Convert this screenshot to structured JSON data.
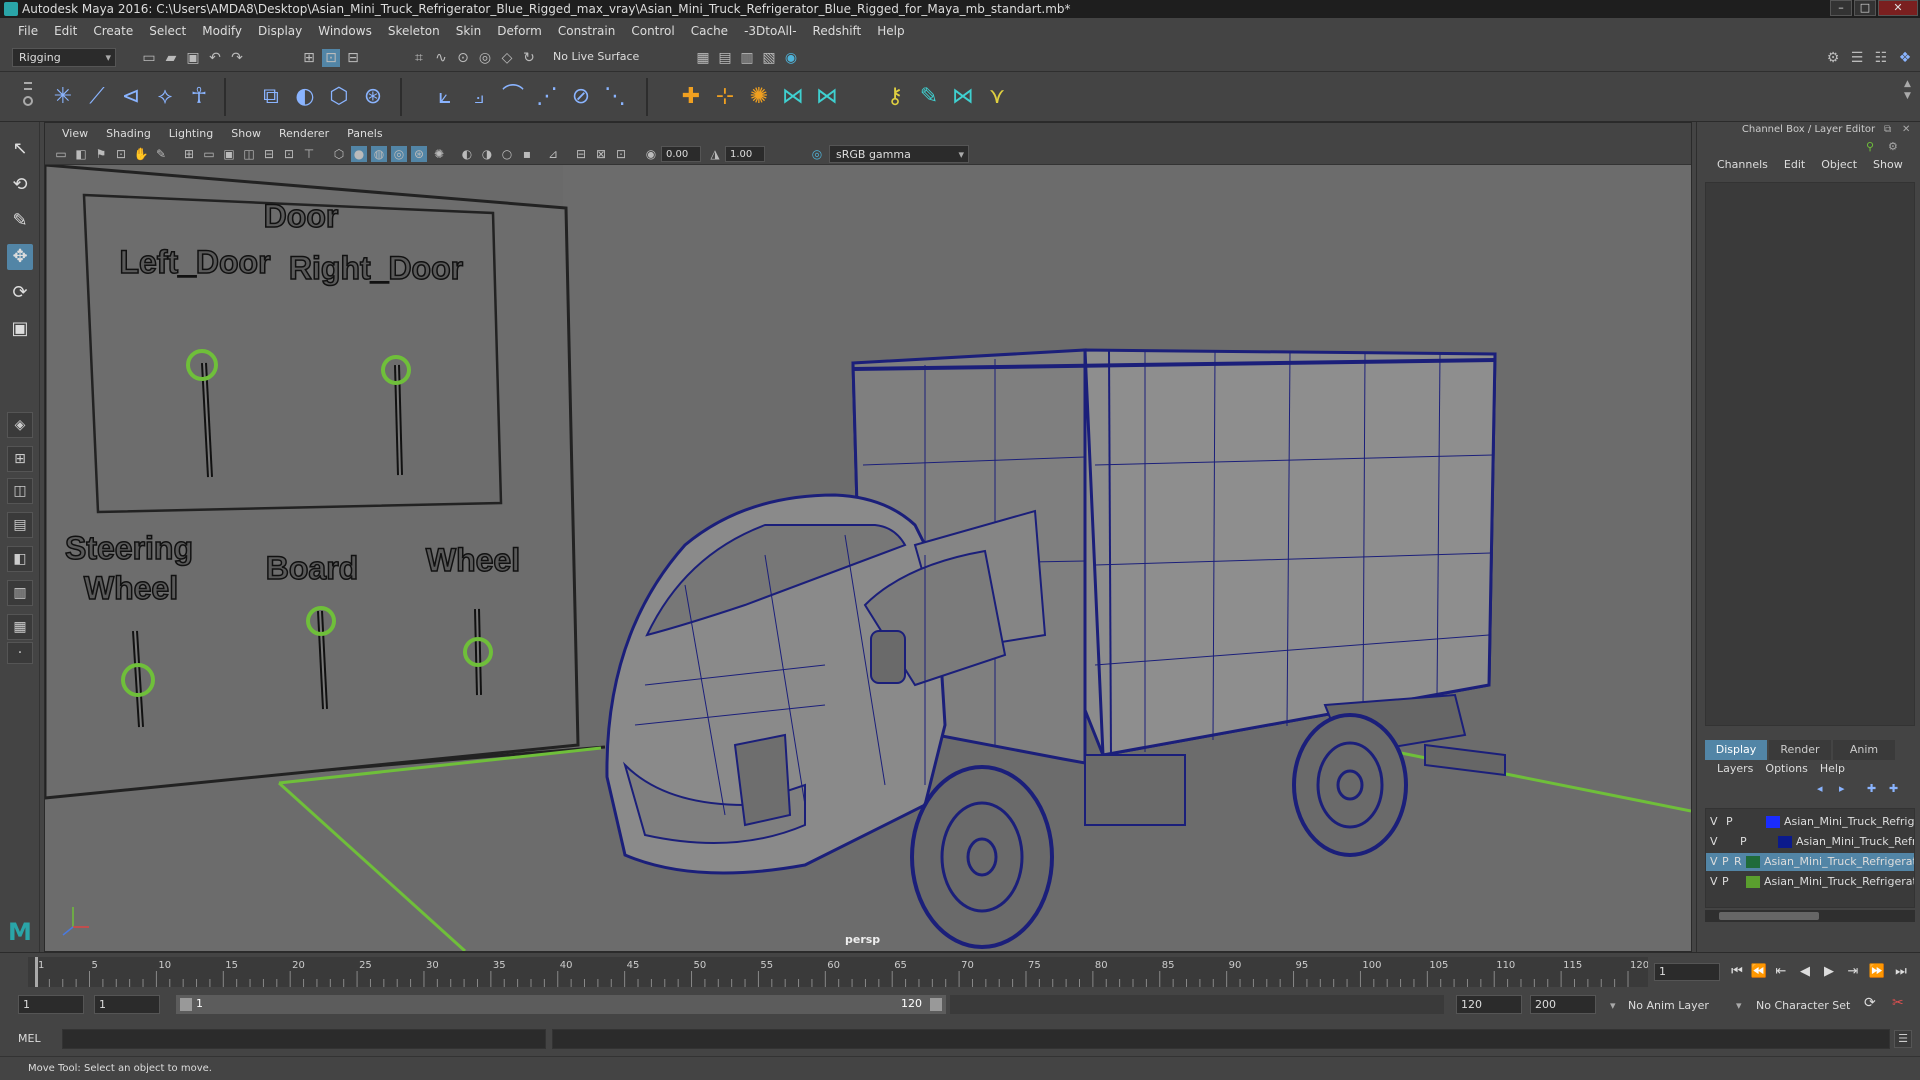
{
  "window": {
    "title": "Autodesk Maya 2016: C:\\Users\\AMDA8\\Desktop\\Asian_Mini_Truck_Refrigerator_Blue_Rigged_max_vray\\Asian_Mini_Truck_Refrigerator_Blue_Rigged_for_Maya_mb_standart.mb*",
    "minimize": "–",
    "maximize": "□",
    "close": "✕"
  },
  "menubar": [
    "File",
    "Edit",
    "Create",
    "Select",
    "Modify",
    "Display",
    "Windows",
    "Skeleton",
    "Skin",
    "Deform",
    "Constrain",
    "Control",
    "Cache",
    "-3DtoAll-",
    "Redshift",
    "Help"
  ],
  "statusline": {
    "menu_set": "Rigging",
    "live_surface": "No Live Surface"
  },
  "viewport": {
    "menu": [
      "View",
      "Shading",
      "Lighting",
      "Show",
      "Renderer",
      "Panels"
    ],
    "exposure": "0.00",
    "gamma": "1.00",
    "color_space": "sRGB gamma",
    "camera": "persp",
    "control_board": {
      "title": "Door",
      "left_door": "Left_Door",
      "right_door": "Right_Door",
      "steering_line1": "Steering",
      "steering_line2": "Wheel",
      "board": "Board",
      "wheel": "Wheel"
    }
  },
  "channelbox": {
    "title": "Channel Box / Layer Editor",
    "menu": [
      "Channels",
      "Edit",
      "Object",
      "Show"
    ],
    "layer_tabs": [
      "Display",
      "Render",
      "Anim"
    ],
    "layer_menu": [
      "Layers",
      "Options",
      "Help"
    ],
    "layers": [
      {
        "v": "V",
        "p": "P",
        "r": "",
        "color": "#1a2cff",
        "name": "Asian_Mini_Truck_Refrigerator"
      },
      {
        "v": "V",
        "p": "P",
        "r": "",
        "color": "#0b1a8c",
        "name": "Asian_Mini_Truck_Refrigerator"
      },
      {
        "v": "V",
        "p": "P",
        "r": "R",
        "color": "#1f6b3a",
        "name": "Asian_Mini_Truck_Refrigerator"
      },
      {
        "v": "V",
        "p": "P",
        "r": "",
        "color": "#5a9e2e",
        "name": "Asian_Mini_Truck_Refrigerator"
      }
    ]
  },
  "timeline": {
    "ticks": [
      "1",
      "5",
      "10",
      "15",
      "20",
      "25",
      "30",
      "35",
      "40",
      "45",
      "50",
      "55",
      "60",
      "65",
      "70",
      "75",
      "80",
      "85",
      "90",
      "95",
      "100",
      "105",
      "110",
      "115",
      "120"
    ],
    "current_frame": "1"
  },
  "range": {
    "start": "1",
    "start_inner": "1",
    "bar_start": "1",
    "bar_end": "120",
    "end_inner": "120",
    "end": "200",
    "anim_layer": "No Anim Layer",
    "char_set": "No Character Set"
  },
  "cmdline": {
    "language": "MEL"
  },
  "help": "Move Tool: Select an object to move.",
  "colors": {
    "wire": "#1b1f7a",
    "manipulator": "#6fbf3a",
    "accent": "#5285a6"
  }
}
